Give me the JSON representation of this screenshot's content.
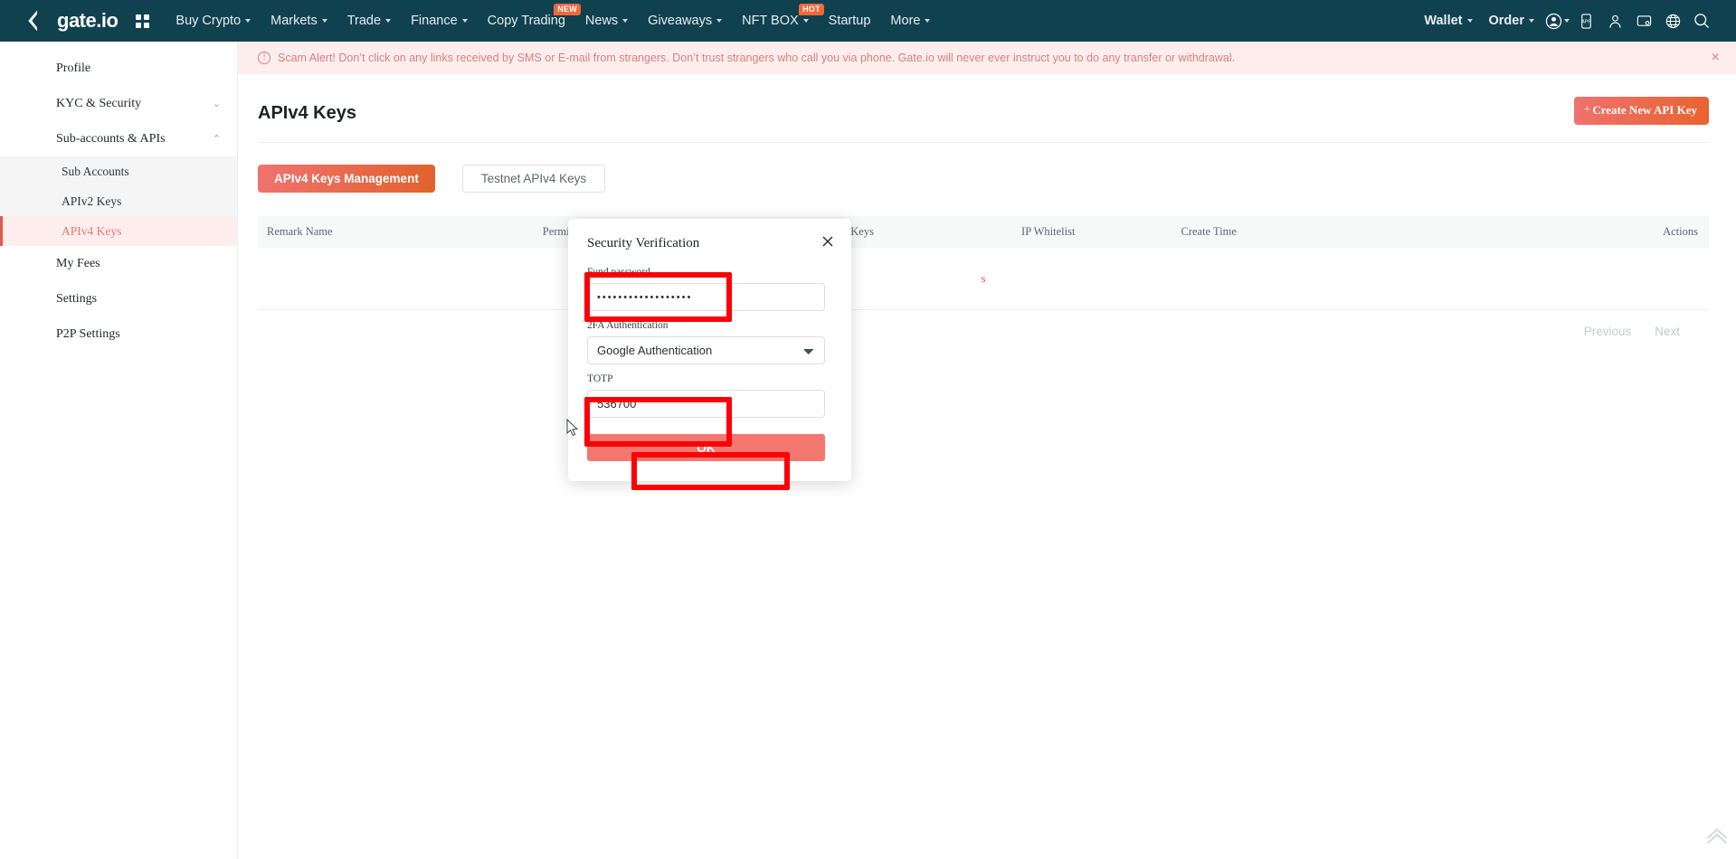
{
  "topnav": {
    "brand": "gate.io",
    "grid_icon": "apps-grid-icon",
    "items": [
      {
        "label": "Buy Crypto",
        "caret": true,
        "badge": ""
      },
      {
        "label": "Markets",
        "caret": true,
        "badge": ""
      },
      {
        "label": "Trade",
        "caret": true,
        "badge": ""
      },
      {
        "label": "Finance",
        "caret": true,
        "badge": ""
      },
      {
        "label": "Copy Trading",
        "caret": false,
        "badge": "NEW"
      },
      {
        "label": "News",
        "caret": true,
        "badge": ""
      },
      {
        "label": "Giveaways",
        "caret": true,
        "badge": ""
      },
      {
        "label": "NFT BOX",
        "caret": true,
        "badge": "HOT"
      },
      {
        "label": "Startup",
        "caret": false,
        "badge": ""
      },
      {
        "label": "More",
        "caret": true,
        "badge": ""
      }
    ],
    "right_items": [
      {
        "label": "Wallet",
        "caret": true
      },
      {
        "label": "Order",
        "caret": true
      }
    ],
    "icons": [
      "account-icon",
      "app-download-icon",
      "support-icon",
      "device-icon",
      "language-icon",
      "search-icon"
    ],
    "bg_color": "#10414f"
  },
  "alert": {
    "icon": "info-circle-icon",
    "text": "Scam Alert! Don’t click on any links received by SMS or E-mail from strangers. Don’t trust strangers who call you via phone. Gate.io will never ever instruct you to do any transfer or withdrawal.",
    "close_label": "×",
    "color": "#d8817c",
    "bg_color": "#fdeeed"
  },
  "sidebar": {
    "items": [
      {
        "label": "Profile",
        "chevron": "",
        "type": "item"
      },
      {
        "label": "KYC & Security",
        "chevron": "⌄",
        "type": "item"
      },
      {
        "label": "Sub-accounts & APIs",
        "chevron": "⌃",
        "type": "item"
      }
    ],
    "subitems": [
      {
        "label": "Sub Accounts",
        "active": false
      },
      {
        "label": "APIv2 Keys",
        "active": false
      },
      {
        "label": "APIv4 Keys",
        "active": true
      }
    ],
    "items_after": [
      {
        "label": "My Fees"
      },
      {
        "label": "Settings"
      },
      {
        "label": "P2P Settings"
      }
    ],
    "active_color": "#e8796f"
  },
  "main": {
    "page_title": "APIv4 Keys",
    "create_button": {
      "plus": "+",
      "label": "Create New API Key"
    },
    "tabs": [
      {
        "label": "APIv4 Keys Management",
        "active": true
      },
      {
        "label": "Testnet APIv4 Keys",
        "active": false
      }
    ],
    "table": {
      "headers": [
        "Remark Name",
        "Permissions",
        "APIv4 Keys",
        "IP Whitelist",
        "Create Time",
        "Actions"
      ],
      "rows": [],
      "empty_text": "s"
    },
    "pagination": {
      "previous": "Previous",
      "next": "Next"
    }
  },
  "modal": {
    "title": "Security Verification",
    "close_icon": "close-icon",
    "fields": {
      "fund_password": {
        "label": "Fund password",
        "value": "••••••••••••••••••",
        "placeholder": ""
      },
      "twofa": {
        "label": "2FA Authentication",
        "value": "Google Authentication",
        "options": [
          "Google Authentication"
        ]
      },
      "totp": {
        "label": "TOTP",
        "value": "536700",
        "placeholder": ""
      }
    },
    "ok_label": "OK",
    "ok_color": "#f4776f"
  },
  "annotations": {
    "color": "#fb0007",
    "boxes": [
      "fund-password-highlight",
      "totp-highlight",
      "ok-button-highlight"
    ]
  },
  "widgets": {
    "back_to_top": "back-to-top-icon"
  }
}
